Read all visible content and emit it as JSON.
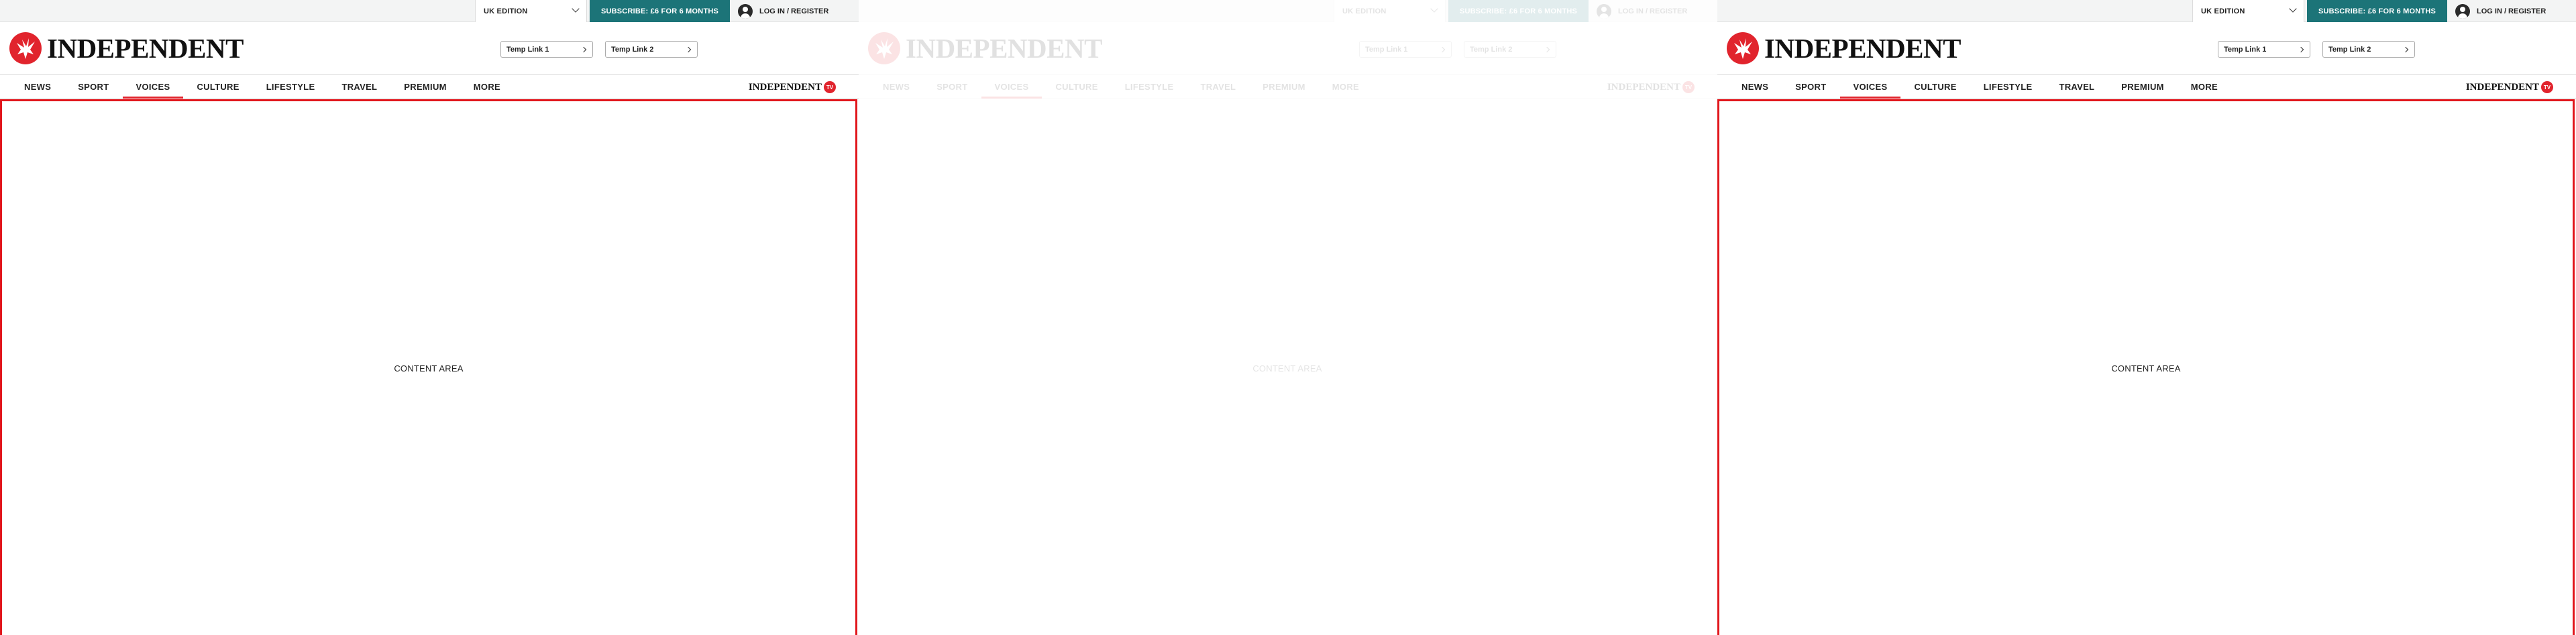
{
  "colors": {
    "brand_red": "#e1242d",
    "subscribe_teal": "#1c7478",
    "content_border": "#e1161c"
  },
  "panels": [
    {
      "state": "normal",
      "topbar": {
        "edition_label": "UK EDITION",
        "subscribe_label": "SUBSCRIBE: £6 FOR 6 MONTHS",
        "login_label": "LOG IN / REGISTER"
      },
      "logo": {
        "wordmark": "INDEPENDENT",
        "icon": "eagle-icon"
      },
      "temp_links": [
        "Temp Link 1",
        "Temp Link 2"
      ],
      "nav": {
        "items": [
          "NEWS",
          "SPORT",
          "VOICES",
          "CULTURE",
          "LIFESTYLE",
          "TRAVEL",
          "PREMIUM",
          "MORE"
        ],
        "active": "VOICES",
        "mini_logo": "INDEPENDENT",
        "tv_badge": "TV"
      },
      "content_label": "CONTENT AREA"
    },
    {
      "state": "faded",
      "topbar": {
        "edition_label": "UK EDITION",
        "subscribe_label": "SUBSCRIBE: £6 FOR 6 MONTHS",
        "login_label": "LOG IN / REGISTER"
      },
      "logo": {
        "wordmark": "INDEPENDENT",
        "icon": "eagle-icon"
      },
      "temp_links": [
        "Temp Link 1",
        "Temp Link 2"
      ],
      "nav": {
        "items": [
          "NEWS",
          "SPORT",
          "VOICES",
          "CULTURE",
          "LIFESTYLE",
          "TRAVEL",
          "PREMIUM",
          "MORE"
        ],
        "active": "VOICES",
        "mini_logo": "INDEPENDENT",
        "tv_badge": "TV"
      },
      "content_label": "CONTENT AREA"
    },
    {
      "state": "normal",
      "topbar": {
        "edition_label": "UK EDITION",
        "subscribe_label": "SUBSCRIBE: £6 FOR 6 MONTHS",
        "login_label": "LOG IN / REGISTER"
      },
      "logo": {
        "wordmark": "INDEPENDENT",
        "icon": "eagle-icon"
      },
      "temp_links": [
        "Temp Link 1",
        "Temp Link 2"
      ],
      "nav": {
        "items": [
          "NEWS",
          "SPORT",
          "VOICES",
          "CULTURE",
          "LIFESTYLE",
          "TRAVEL",
          "PREMIUM",
          "MORE"
        ],
        "active": "VOICES",
        "mini_logo": "INDEPENDENT",
        "tv_badge": "TV"
      },
      "content_label": "CONTENT AREA"
    }
  ]
}
